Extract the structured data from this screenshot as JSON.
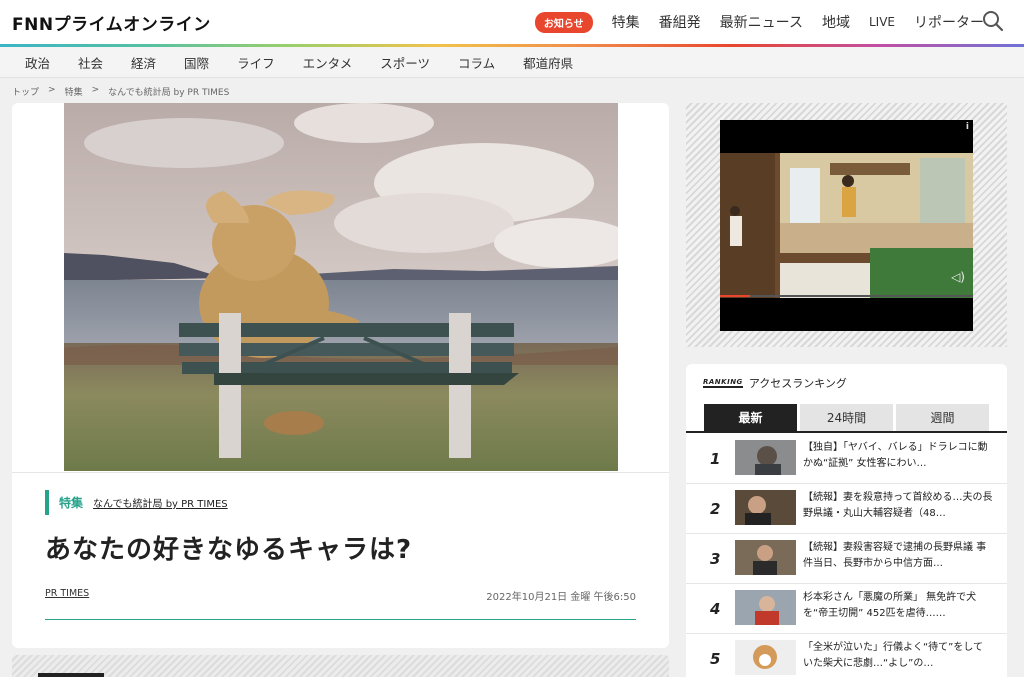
{
  "header": {
    "logo": "FNNプライムオンライン",
    "notice_label": "お知らせ",
    "nav": [
      "特集",
      "番組発",
      "最新ニュース",
      "地域",
      "LIVE",
      "リポーター"
    ]
  },
  "categories": [
    "政治",
    "社会",
    "経済",
    "国際",
    "ライフ",
    "エンタメ",
    "スポーツ",
    "コラム",
    "都道府県"
  ],
  "breadcrumb": [
    "トップ",
    ">",
    "特集",
    ">",
    "なんでも統計局 by PR TIMES"
  ],
  "article": {
    "category": "特集",
    "subcategory": "なんでも統計局 by PR TIMES",
    "title": "あなたの好きなゆるキャラは?",
    "author": "PR TIMES",
    "datetime": "2022年10月21日 金曜 午後6:50"
  },
  "video": {
    "info_label": "i",
    "progress": 0.12
  },
  "ranking": {
    "badge": "RANKING",
    "title": "アクセスランキング",
    "tabs": [
      "最新",
      "24時間",
      "週間"
    ],
    "active_tab": 0,
    "items": [
      {
        "rank": "1",
        "text": "【独自】「ヤバイ、バレる」ドラレコに動かぬ“証拠” 女性客にわい…"
      },
      {
        "rank": "2",
        "text": "【続報】妻を殺意持って首絞める…夫の長野県議・丸山大輔容疑者（48…"
      },
      {
        "rank": "3",
        "text": "【続報】妻殺害容疑で逮捕の長野県議 事件当日、長野市から中信方面…"
      },
      {
        "rank": "4",
        "text": "杉本彩さん「悪魔の所業」 無免許で犬を“帝王切開” 452匹を虐待……"
      },
      {
        "rank": "5",
        "text": "「全米が泣いた」行儀よく“待て”をしていた柴犬に悲劇…“よし”の…"
      }
    ]
  },
  "colors": {
    "accent": "#27a38a",
    "notice": "#e8462d",
    "tab_active": "#222222"
  }
}
